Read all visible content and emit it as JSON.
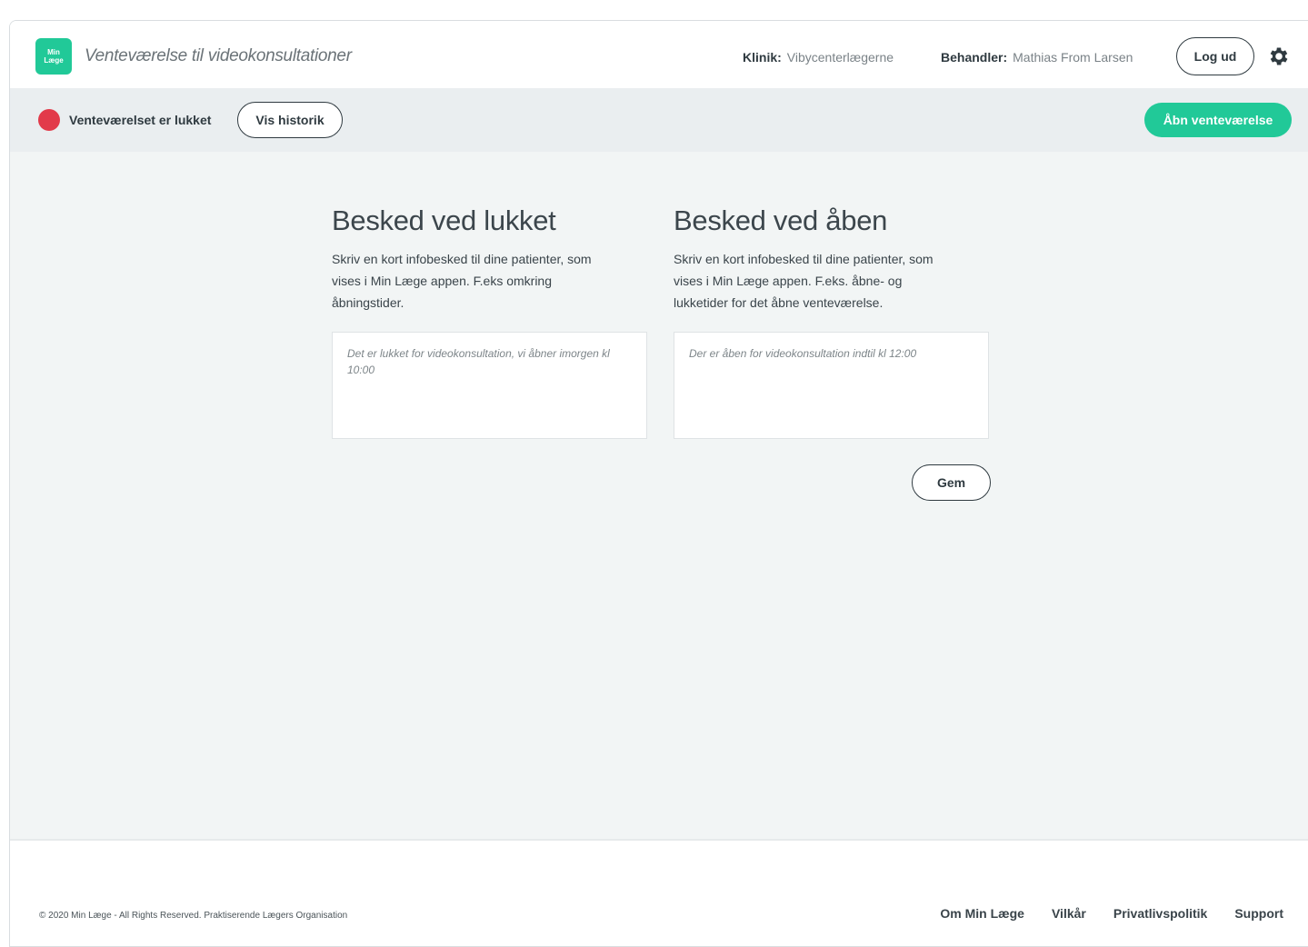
{
  "header": {
    "logo_line1": "Min",
    "logo_line2": "Læge",
    "title": "Venteværelse til videokonsultationer",
    "clinic_label": "Klinik:",
    "clinic_value": "Vibycenterlægerne",
    "treater_label": "Behandler:",
    "treater_value": "Mathias From Larsen",
    "logout_label": "Log ud",
    "settings_icon": "gear-icon"
  },
  "status": {
    "text": "Venteværelset er lukket",
    "dot_color": "#e23a4a",
    "history_label": "Vis historik",
    "open_label": "Åbn venteværelse"
  },
  "closed_message": {
    "heading": "Besked ved lukket",
    "description": "Skriv en kort infobesked til dine patienter, som vises i Min Læge appen. F.eks omkring åbningstider.",
    "placeholder": "Det er lukket for videokonsultation, vi åbner imorgen kl 10:00"
  },
  "open_message": {
    "heading": "Besked ved åben",
    "description": "Skriv en kort infobesked til dine patienter, som vises i Min Læge appen. F.eks. åbne- og lukketider for det åbne venteværelse.",
    "placeholder": "Der er åben for videokonsultation indtil kl 12:00"
  },
  "save_label": "Gem",
  "footer": {
    "copyright": "© 2020 Min Læge - All Rights Reserved. Praktiserende Lægers Organisation",
    "links": [
      "Om Min Læge",
      "Vilkår",
      "Privatlivspolitik",
      "Support"
    ]
  },
  "colors": {
    "accent": "#21c998",
    "status_closed": "#e23a4a",
    "status_bar_bg": "#eaeef0",
    "main_bg": "#f2f5f5"
  }
}
